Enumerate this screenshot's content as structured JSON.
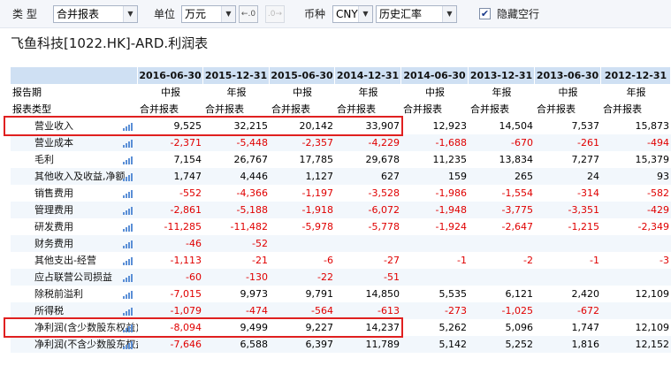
{
  "toolbar": {
    "type_label": "类 型",
    "type_value": "合并报表",
    "unit_label": "单位",
    "unit_value": "万元",
    "currency_label": "币种",
    "currency_value": "CNY",
    "rate_value": "历史汇率",
    "hide_empty_label": "隐藏空行",
    "hide_empty_checked": "✔"
  },
  "page": {
    "title": "飞鱼科技[1022.HK]-ARD.利润表"
  },
  "table": {
    "dates": [
      "2016-06-30",
      "2015-12-31",
      "2015-06-30",
      "2014-12-31",
      "2014-06-30",
      "2013-12-31",
      "2013-06-30",
      "2012-12-31"
    ],
    "report_period_label": "报告期",
    "periods": [
      "中报",
      "年报",
      "中报",
      "年报",
      "中报",
      "年报",
      "中报",
      "年报"
    ],
    "report_type_label": "报表类型",
    "types": [
      "合并报表",
      "合并报表",
      "合并报表",
      "合并报表",
      "合并报表",
      "合并报表",
      "合并报表",
      "合并报表"
    ],
    "rows": [
      {
        "label": "营业收入",
        "values": [
          "9,525",
          "32,215",
          "20,142",
          "33,907",
          "12,923",
          "14,504",
          "7,537",
          "15,873"
        ]
      },
      {
        "label": "营业成本",
        "values": [
          "-2,371",
          "-5,448",
          "-2,357",
          "-4,229",
          "-1,688",
          "-670",
          "-261",
          "-494"
        ]
      },
      {
        "label": "毛利",
        "values": [
          "7,154",
          "26,767",
          "17,785",
          "29,678",
          "11,235",
          "13,834",
          "7,277",
          "15,379"
        ]
      },
      {
        "label": "其他收入及收益,净额",
        "values": [
          "1,747",
          "4,446",
          "1,127",
          "627",
          "159",
          "265",
          "24",
          "93"
        ]
      },
      {
        "label": "销售费用",
        "values": [
          "-552",
          "-4,366",
          "-1,197",
          "-3,528",
          "-1,986",
          "-1,554",
          "-314",
          "-582"
        ]
      },
      {
        "label": "管理费用",
        "values": [
          "-2,861",
          "-5,188",
          "-1,918",
          "-6,072",
          "-1,948",
          "-3,775",
          "-3,351",
          "-429"
        ]
      },
      {
        "label": "研发费用",
        "values": [
          "-11,285",
          "-11,482",
          "-5,978",
          "-5,778",
          "-1,924",
          "-2,647",
          "-1,215",
          "-2,349"
        ]
      },
      {
        "label": "财务费用",
        "values": [
          "-46",
          "-52",
          "",
          "",
          "",
          "",
          "",
          ""
        ]
      },
      {
        "label": "其他支出-经营",
        "values": [
          "-1,113",
          "-21",
          "-6",
          "-27",
          "-1",
          "-2",
          "-1",
          "-3"
        ]
      },
      {
        "label": "应占联营公司损益",
        "values": [
          "-60",
          "-130",
          "-22",
          "-51",
          "",
          "",
          "",
          ""
        ]
      },
      {
        "label": "除税前溢利",
        "values": [
          "-7,015",
          "9,973",
          "9,791",
          "14,850",
          "5,535",
          "6,121",
          "2,420",
          "12,109"
        ]
      },
      {
        "label": "所得税",
        "values": [
          "-1,079",
          "-474",
          "-564",
          "-613",
          "-273",
          "-1,025",
          "-672",
          ""
        ]
      },
      {
        "label": "净利润(含少数股东权益)",
        "values": [
          "-8,094",
          "9,499",
          "9,227",
          "14,237",
          "5,262",
          "5,096",
          "1,747",
          "12,109"
        ]
      },
      {
        "label": "净利润(不含少数股东权益)",
        "values": [
          "-7,646",
          "6,588",
          "6,397",
          "11,789",
          "5,142",
          "5,252",
          "1,816",
          "12,152"
        ]
      }
    ]
  }
}
